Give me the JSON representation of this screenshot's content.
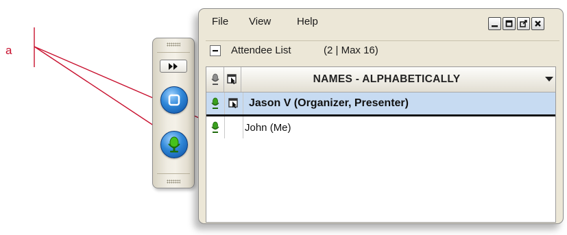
{
  "annotation": {
    "letter": "a",
    "color": "#c8102e"
  },
  "toolbar": {
    "fast_forward_icon": "fast-forward-icon",
    "screen_button_icon": "screen-share-icon",
    "mic_button_icon": "microphone-icon"
  },
  "window": {
    "menu": [
      "File",
      "View",
      "Help"
    ],
    "controls": [
      "minimize-icon",
      "maximize-icon",
      "popout-icon",
      "close-icon"
    ]
  },
  "attendee_section": {
    "collapse_symbol": "−",
    "title": "Attendee List",
    "count": "(2 | Max 16)"
  },
  "list": {
    "header": {
      "names": "NAMES - ALPHABETICALLY"
    },
    "rows": [
      {
        "name": "Jason V (Organizer, Presenter)",
        "selected": true,
        "presenter_icon": true
      },
      {
        "name": "John (Me)",
        "selected": false,
        "presenter_icon": false
      }
    ],
    "colors": {
      "selection": "#c7dbf2",
      "mic_green": "#3aa01e"
    }
  }
}
